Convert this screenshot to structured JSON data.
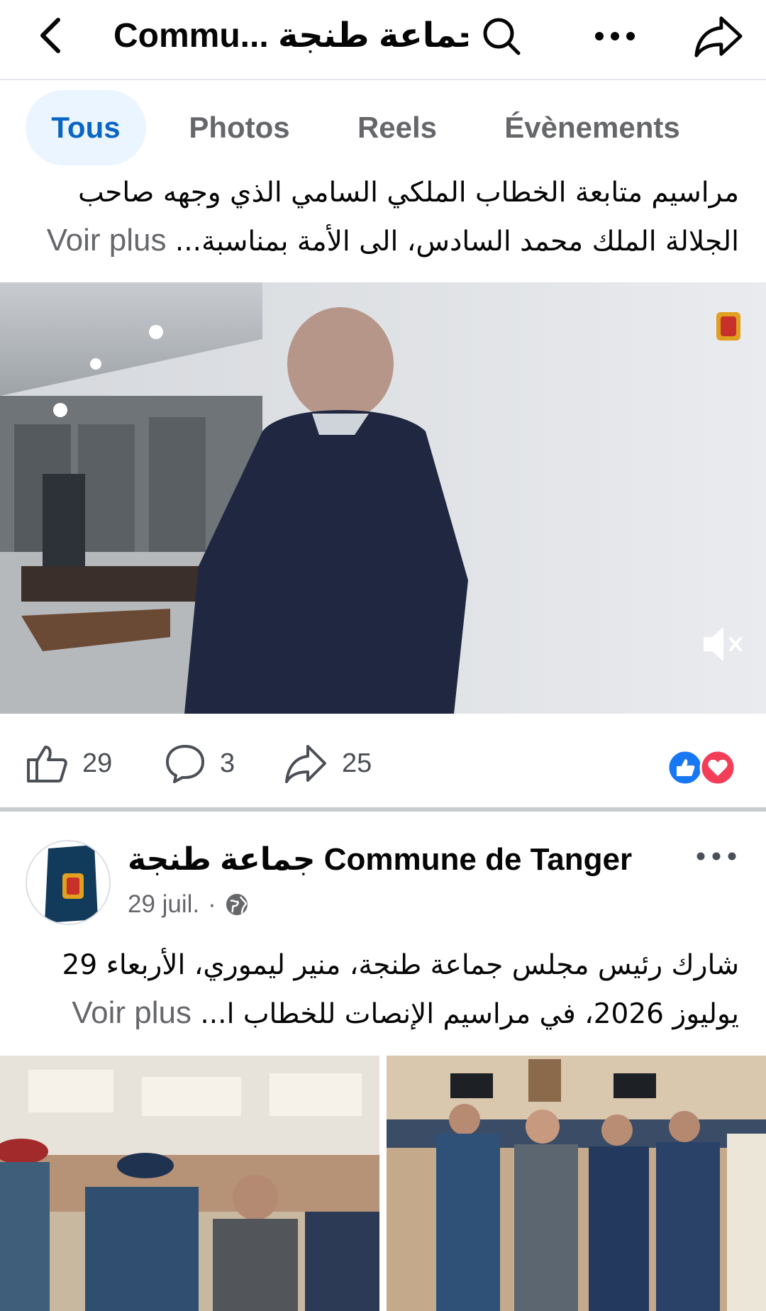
{
  "header": {
    "title": "Commu... جماعة طنجة",
    "back_icon": "chevron-left-icon",
    "search_icon": "search-icon",
    "more_icon": "more-horizontal-icon",
    "share_icon": "share-arrow-icon"
  },
  "tabs": [
    {
      "label": "Tous",
      "active": true
    },
    {
      "label": "Photos",
      "active": false
    },
    {
      "label": "Reels",
      "active": false
    },
    {
      "label": "Évènements",
      "active": false
    }
  ],
  "post1": {
    "caption_line1": "مراسيم متابعة الخطاب الملكي السامي الذي وجهه صاحب",
    "caption_line2": "الجلالة الملك محمد السادس، الى الأمة بمناسبة...",
    "see_more": "Voir plus",
    "video_muted_icon": "speaker-muted-icon",
    "likes": "29",
    "comments": "3",
    "shares": "25",
    "reaction_icons": [
      "like-reaction-icon",
      "love-reaction-icon"
    ]
  },
  "post2": {
    "author": "جماعة طنجة Commune de Tanger",
    "date": "29 juil.",
    "separator": "·",
    "privacy_icon": "globe-icon",
    "caption_line1": "شارك رئيس مجلس جماعة طنجة، منير ليموري، الأربعاء 29",
    "caption_line2": "يوليوز 2026، في مراسيم الإنصات للخطاب ا...",
    "see_more": "Voir plus"
  },
  "colors": {
    "accent": "#0a66c2",
    "tab_active_bg": "#ebf5ff",
    "secondary_text": "#65676b",
    "like_blue": "#1877f2",
    "love_red": "#f33e58"
  }
}
